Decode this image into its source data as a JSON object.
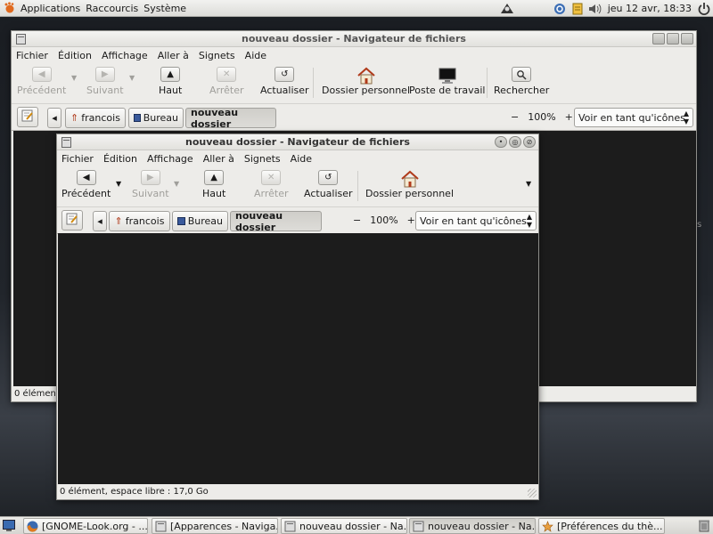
{
  "top_panel": {
    "menus": [
      "Applications",
      "Raccourcis",
      "Système"
    ],
    "clock": "jeu 12 avr, 18:33"
  },
  "back_window": {
    "title": "nouveau dossier - Navigateur de fichiers",
    "menus": [
      "Fichier",
      "Édition",
      "Affichage",
      "Aller à",
      "Signets",
      "Aide"
    ],
    "toolbar": {
      "back": "Précédent",
      "forward": "Suivant",
      "up": "Haut",
      "stop": "Arrêter",
      "reload": "Actualiser",
      "home": "Dossier personnel",
      "computer": "Poste de travail",
      "search": "Rechercher"
    },
    "path": [
      "francois",
      "Bureau",
      "nouveau dossier"
    ],
    "zoom": "100%",
    "view_mode": "Voir en tant qu'icônes",
    "status": "0 élémen"
  },
  "front_window": {
    "title": "nouveau dossier - Navigateur de fichiers",
    "menus": [
      "Fichier",
      "Édition",
      "Affichage",
      "Aller à",
      "Signets",
      "Aide"
    ],
    "toolbar": {
      "back": "Précédent",
      "forward": "Suivant",
      "up": "Haut",
      "stop": "Arrêter",
      "reload": "Actualiser",
      "home": "Dossier personnel"
    },
    "path": [
      "francois",
      "Bureau",
      "nouveau dossier"
    ],
    "zoom": "100%",
    "view_mode": "Voir en tant qu'icônes",
    "status": "0 élément, espace libre : 17,0 Go"
  },
  "taskbar": {
    "tasks": [
      "[GNOME-Look.org - ...",
      "[Apparences - Naviga...",
      "nouveau dossier - Na...",
      "nouveau dossier - Na...",
      "[Préférences du thè..."
    ]
  },
  "desktop": {
    "edge_text": "s"
  },
  "colors": {
    "panel": "#dcdcd8",
    "window": "#edece9",
    "content": "#1c1c1c",
    "desktop": "#22262c"
  }
}
